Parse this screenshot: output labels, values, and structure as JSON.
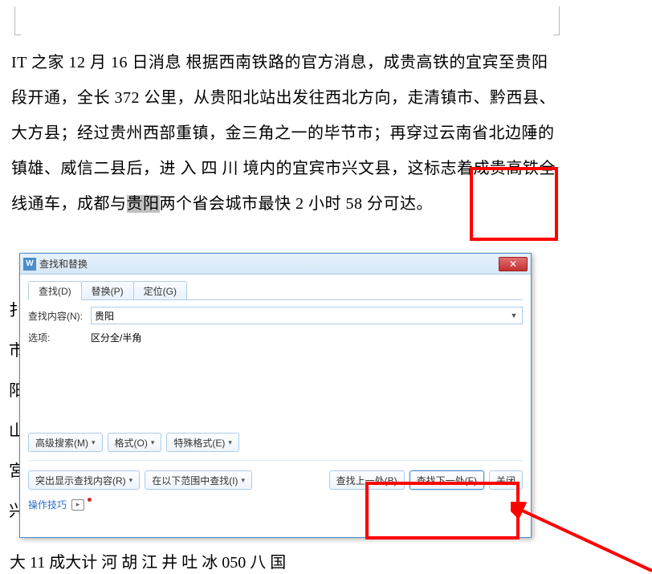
{
  "document": {
    "paragraph": "IT 之家 12 月 16 日消息 根据西南铁路的官方消息，成贵高铁的宜宾至贵阳段开通，全长 372 公里，从贵阳北站出发往西北方向，走清镇市、黔西县、大方县；经过贵州西部重镇，金三角之一的毕节市；再穿过云南省北边陲的镇雄、威信二县后，进 入 四 川 境内的宜宾市兴文县，这标志着成贵高铁全线通车，成都与",
    "selected": "贵阳",
    "after": "两个省会城市最快 2 小时 58 分可达。",
    "behind_chars": [
      "扌",
      "市",
      "阳",
      "山",
      "宮",
      "兴"
    ],
    "bottom_hint": "大 11 成大计   河 胡 江 井 吐 冰 050 八 国"
  },
  "dialog": {
    "title": "查找和替换",
    "tabs": {
      "find": "查找(D)",
      "replace": "替换(P)",
      "goto": "定位(G)"
    },
    "find_label": "查找内容(N):",
    "find_value": "贵阳",
    "options_label": "选项:",
    "options_value": "区分全/半角",
    "adv_search": "高级搜索(M)",
    "format": "格式(O)",
    "special": "特殊格式(E)",
    "highlight_found": "突出显示查找内容(R)",
    "search_in": "在以下范围中查找(I)",
    "find_prev": "查找上一处(B)",
    "find_next": "查找下一处(F)",
    "close": "关闭",
    "tips": "操作技巧"
  }
}
